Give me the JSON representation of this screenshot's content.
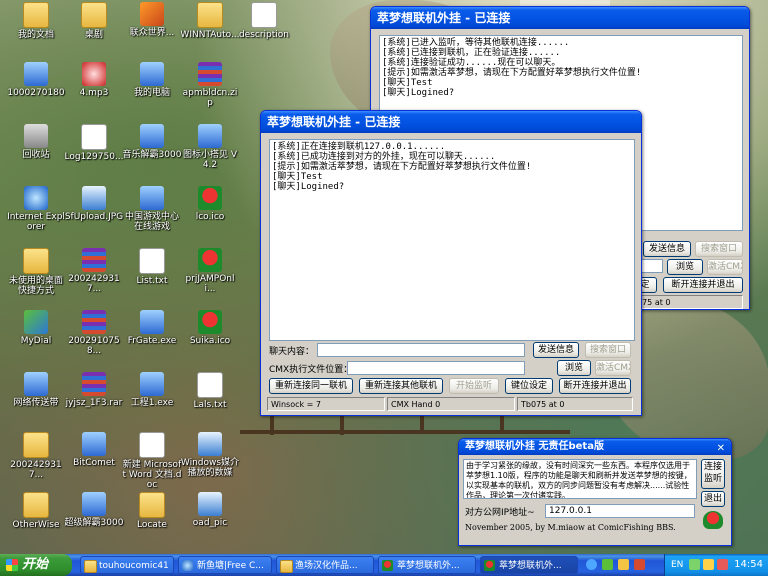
{
  "desktop": {
    "icons": [
      {
        "label": "我的文档",
        "kind": "folder-icon"
      },
      {
        "label": "桌剧",
        "kind": "folder-icon"
      },
      {
        "label": "联众世界...",
        "kind": "house-icon"
      },
      {
        "label": "WINNTAuto...",
        "kind": "folder-icon"
      },
      {
        "label": "description",
        "kind": "document-icon"
      },
      {
        "label": "1000270180",
        "kind": "computer-icon"
      },
      {
        "label": "4.mp3",
        "kind": "audio-file-icon"
      },
      {
        "label": "我的电脑",
        "kind": "computer-icon"
      },
      {
        "label": "apmbldcn.zip",
        "kind": "archive-icon"
      },
      {
        "label": "回收站",
        "kind": "recycle-bin-icon"
      },
      {
        "label": "Log129750...",
        "kind": "document-icon"
      },
      {
        "label": "音乐解霸3000",
        "kind": "app-icon"
      },
      {
        "label": "图标小搭见 V4.2",
        "kind": "app-icon"
      },
      {
        "label": "Internet Explorer",
        "kind": "ie-icon"
      },
      {
        "label": "SfUpload.JPG",
        "kind": "image-file-icon"
      },
      {
        "label": "中国游戏中心 在线游戏",
        "kind": "app-icon"
      },
      {
        "label": "lco.ico",
        "kind": "melon-icon"
      },
      {
        "label": "未使用的桌面 快捷方式",
        "kind": "folder-icon"
      },
      {
        "label": "2002429317...",
        "kind": "archive-icon"
      },
      {
        "label": "List.txt",
        "kind": "text-file-icon"
      },
      {
        "label": "prjJAMPOnli...",
        "kind": "melon-icon"
      },
      {
        "label": "MyDial",
        "kind": "network-icon"
      },
      {
        "label": "2002910758...",
        "kind": "archive-icon"
      },
      {
        "label": "FrGate.exe",
        "kind": "app-icon"
      },
      {
        "label": "Suika.ico",
        "kind": "melon-icon"
      },
      {
        "label": "网络传送带",
        "kind": "app-icon"
      },
      {
        "label": "jyjsz_1F3.rar",
        "kind": "archive-icon"
      },
      {
        "label": "工程1.exe",
        "kind": "app-icon"
      },
      {
        "label": "Lals.txt",
        "kind": "text-file-icon"
      },
      {
        "label": "2002429317...",
        "kind": "folder-icon"
      },
      {
        "label": "BitComet",
        "kind": "app-icon"
      },
      {
        "label": "新建 Microsoft Word 文档.doc",
        "kind": "word-doc-icon"
      },
      {
        "label": "Windows媒介 播放的数媒",
        "kind": "media-file-icon"
      },
      {
        "label": "OtherWise",
        "kind": "folder-icon"
      },
      {
        "label": "超级解霸3000",
        "kind": "app-icon"
      },
      {
        "label": "Locate",
        "kind": "folder-icon"
      },
      {
        "label": "oad_pic",
        "kind": "image-file-icon"
      }
    ]
  },
  "back_window": {
    "title": "萃梦想联机外挂 - 已连接",
    "log": "[系统]已进入监听，等待其他联机连接......\n[系统]已连接到联机，正在验证连接......\n[系统]连接验证成功......现在可以聊天。\n[提示]如需激活萃梦想，请现在下方配置好萃梦想执行文件位置!\n[聊天]Test\n[聊天]Logined?",
    "send_label": "发送信息",
    "search_label": "搜索窗口",
    "browse_label": "浏览",
    "activate_label": "激活CMX",
    "set_label": "定",
    "disconnect_label": "断开连接并退出",
    "status_text": "075 at 0"
  },
  "front_window": {
    "title": "萃梦想联机外挂 - 已连接",
    "log": "[系统]正在连接到联机127.0.0.1......\n[系统]已成功连接到对方的外挂，现在可以聊天......\n[提示]如需激活萃梦想，请现在下方配置好萃梦想执行文件位置!\n[聊天]Test\n[聊天]Logined?",
    "chat_label": "聊天内容：",
    "chat_value": "",
    "send_label": "发送信息",
    "search_label": "搜索窗口",
    "cmx_label": "CMX执行文件位置：",
    "cmx_value": "",
    "browse_label": "浏览",
    "activate_label": "激活CMX",
    "reconnect_same_label": "重新连接同一联机",
    "reconnect_other_label": "重新连接其他联机",
    "start_listen_label": "开始监听",
    "key_set_label": "键位设定",
    "disconnect_label": "断开连接并退出",
    "status": [
      "Winsock = 7",
      "CMX Hand 0",
      "Tb075 at 0"
    ]
  },
  "small_window": {
    "title": "萃梦想联机外挂 无责任beta版",
    "intro": "由于学习紧张的缘故，没有时间深究一些东西。本程序仅选用于萃梦想1.10版，程序的功能是聊天和刷新并发送萃梦想的按键，以实现基本的联机，双方的同步问题暂没有考虑解决......试验性作品，理论第一次付诸实践。",
    "connect_label": "连接",
    "listen_label": "监听",
    "exit_label": "退出",
    "ip_label": "对方公网IP地址~",
    "ip_value": "127.0.0.1",
    "credit": "November 2005, by M.miaow at ComicFishing BBS."
  },
  "taskbar": {
    "start_label": "开始",
    "tasks": [
      {
        "label": "touhoucomic41"
      },
      {
        "label": "新鱼塘|Free C..."
      },
      {
        "label": "渔场汉化作品..."
      },
      {
        "label": "萃梦想联机外..."
      },
      {
        "label": "萃梦想联机外..."
      }
    ],
    "tray_lang": "EN",
    "clock": "14:54"
  }
}
